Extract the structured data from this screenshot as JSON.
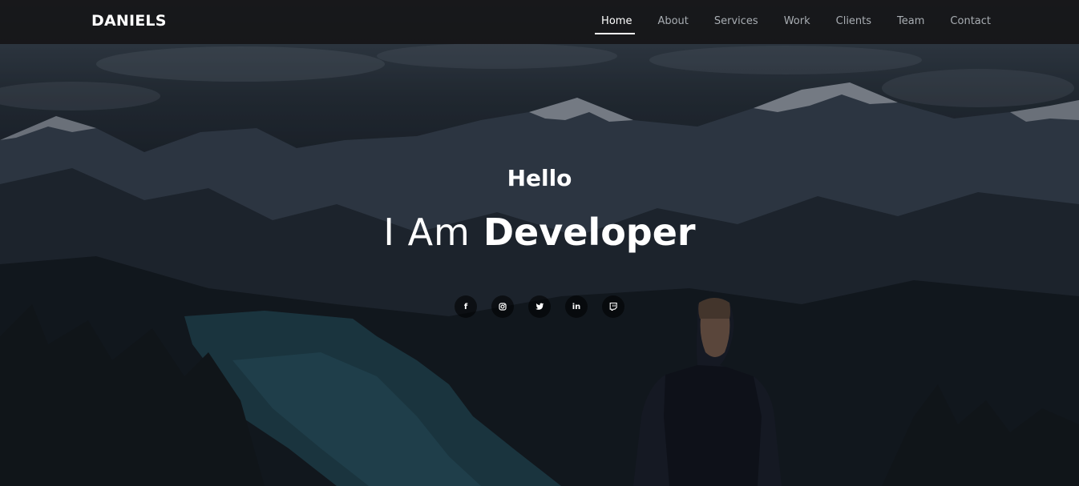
{
  "brand": {
    "name": "DANIELS"
  },
  "nav": {
    "items": [
      {
        "label": "Home",
        "active": true
      },
      {
        "label": "About",
        "active": false
      },
      {
        "label": "Services",
        "active": false
      },
      {
        "label": "Work",
        "active": false
      },
      {
        "label": "Clients",
        "active": false
      },
      {
        "label": "Team",
        "active": false
      },
      {
        "label": "Contact",
        "active": false
      }
    ]
  },
  "hero": {
    "greeting": "Hello",
    "title_prefix": "I Am",
    "title_emphasis": "Developer",
    "background_image": "mountain-lake-landscape"
  },
  "social": [
    {
      "icon": "facebook-icon",
      "glyph": "f"
    },
    {
      "icon": "instagram-icon",
      "glyph": ""
    },
    {
      "icon": "twitter-icon",
      "glyph": ""
    },
    {
      "icon": "linkedin-icon",
      "glyph": "in"
    },
    {
      "icon": "twitch-icon",
      "glyph": ""
    }
  ],
  "colors": {
    "nav_background": "#161618",
    "nav_text": "#a9aeb3",
    "nav_active": "#ffffff",
    "text": "#ffffff"
  }
}
